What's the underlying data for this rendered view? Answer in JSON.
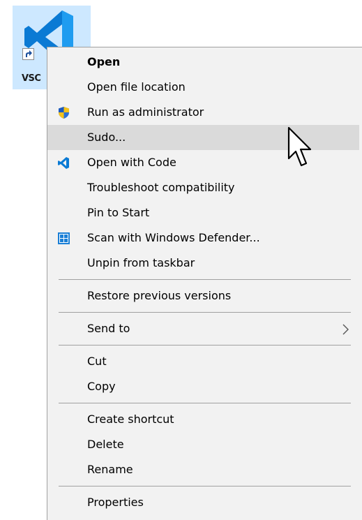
{
  "desktop": {
    "shortcut_label": "VSC"
  },
  "menu": {
    "items": [
      {
        "label": "Open",
        "icon": "",
        "bold": true
      },
      {
        "label": "Open file location",
        "icon": ""
      },
      {
        "label": "Run as administrator",
        "icon": "uac-shield-icon"
      },
      {
        "label": "Sudo...",
        "icon": "",
        "hovered": true
      },
      {
        "label": "Open with Code",
        "icon": "vscode-icon"
      },
      {
        "label": "Troubleshoot compatibility",
        "icon": ""
      },
      {
        "label": "Pin to Start",
        "icon": ""
      },
      {
        "label": "Scan with Windows Defender...",
        "icon": "windows-defender-icon"
      },
      {
        "label": "Unpin from taskbar",
        "icon": ""
      },
      {
        "label": "Restore previous versions",
        "icon": ""
      },
      {
        "label": "Send to",
        "icon": "",
        "submenu": true
      },
      {
        "label": "Cut",
        "icon": ""
      },
      {
        "label": "Copy",
        "icon": ""
      },
      {
        "label": "Create shortcut",
        "icon": ""
      },
      {
        "label": "Delete",
        "icon": ""
      },
      {
        "label": "Rename",
        "icon": ""
      },
      {
        "label": "Properties",
        "icon": ""
      }
    ]
  },
  "colors": {
    "menu_background": "#f2f2f2",
    "hover_background": "#dadada",
    "separator": "#a0a0a0",
    "selection_background": "#cde8ff",
    "vscode_blue": "#0a7ad4"
  }
}
